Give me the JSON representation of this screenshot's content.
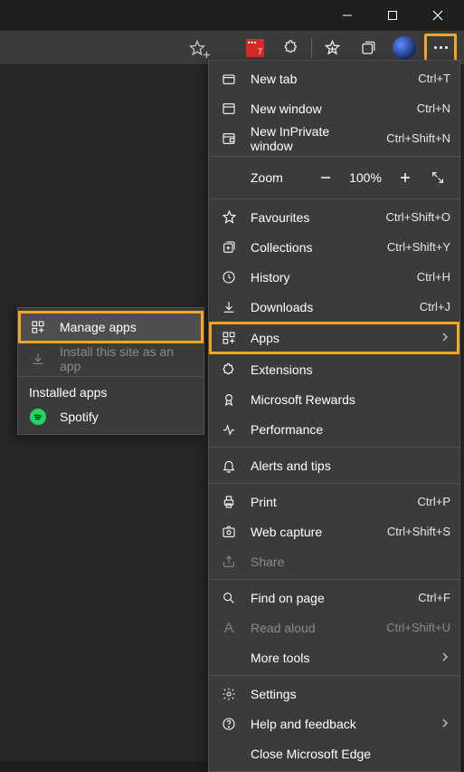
{
  "window": {
    "minimize": "—",
    "maximize": "☐",
    "close": "✕"
  },
  "toolbar": {
    "ext_badge_num": "7"
  },
  "menu": {
    "new_tab": {
      "label": "New tab",
      "shortcut": "Ctrl+T"
    },
    "new_window": {
      "label": "New window",
      "shortcut": "Ctrl+N"
    },
    "new_inprivate": {
      "label": "New InPrivate window",
      "shortcut": "Ctrl+Shift+N"
    },
    "zoom": {
      "label": "Zoom",
      "minus": "—",
      "value": "100%",
      "plus": "+"
    },
    "favourites": {
      "label": "Favourites",
      "shortcut": "Ctrl+Shift+O"
    },
    "collections": {
      "label": "Collections",
      "shortcut": "Ctrl+Shift+Y"
    },
    "history": {
      "label": "History",
      "shortcut": "Ctrl+H"
    },
    "downloads": {
      "label": "Downloads",
      "shortcut": "Ctrl+J"
    },
    "apps": {
      "label": "Apps"
    },
    "extensions": {
      "label": "Extensions"
    },
    "ms_rewards": {
      "label": "Microsoft Rewards"
    },
    "performance": {
      "label": "Performance"
    },
    "alerts": {
      "label": "Alerts and tips"
    },
    "print": {
      "label": "Print",
      "shortcut": "Ctrl+P"
    },
    "web_capture": {
      "label": "Web capture",
      "shortcut": "Ctrl+Shift+S"
    },
    "share": {
      "label": "Share"
    },
    "find": {
      "label": "Find on page",
      "shortcut": "Ctrl+F"
    },
    "read_aloud": {
      "label": "Read aloud",
      "shortcut": "Ctrl+Shift+U"
    },
    "more_tools": {
      "label": "More tools"
    },
    "settings": {
      "label": "Settings"
    },
    "help": {
      "label": "Help and feedback"
    },
    "close_edge": {
      "label": "Close Microsoft Edge"
    }
  },
  "submenu": {
    "manage": {
      "label": "Manage apps"
    },
    "install": {
      "label": "Install this site as an app"
    },
    "installed_header": "Installed apps",
    "items": [
      {
        "label": "Spotify"
      }
    ]
  }
}
